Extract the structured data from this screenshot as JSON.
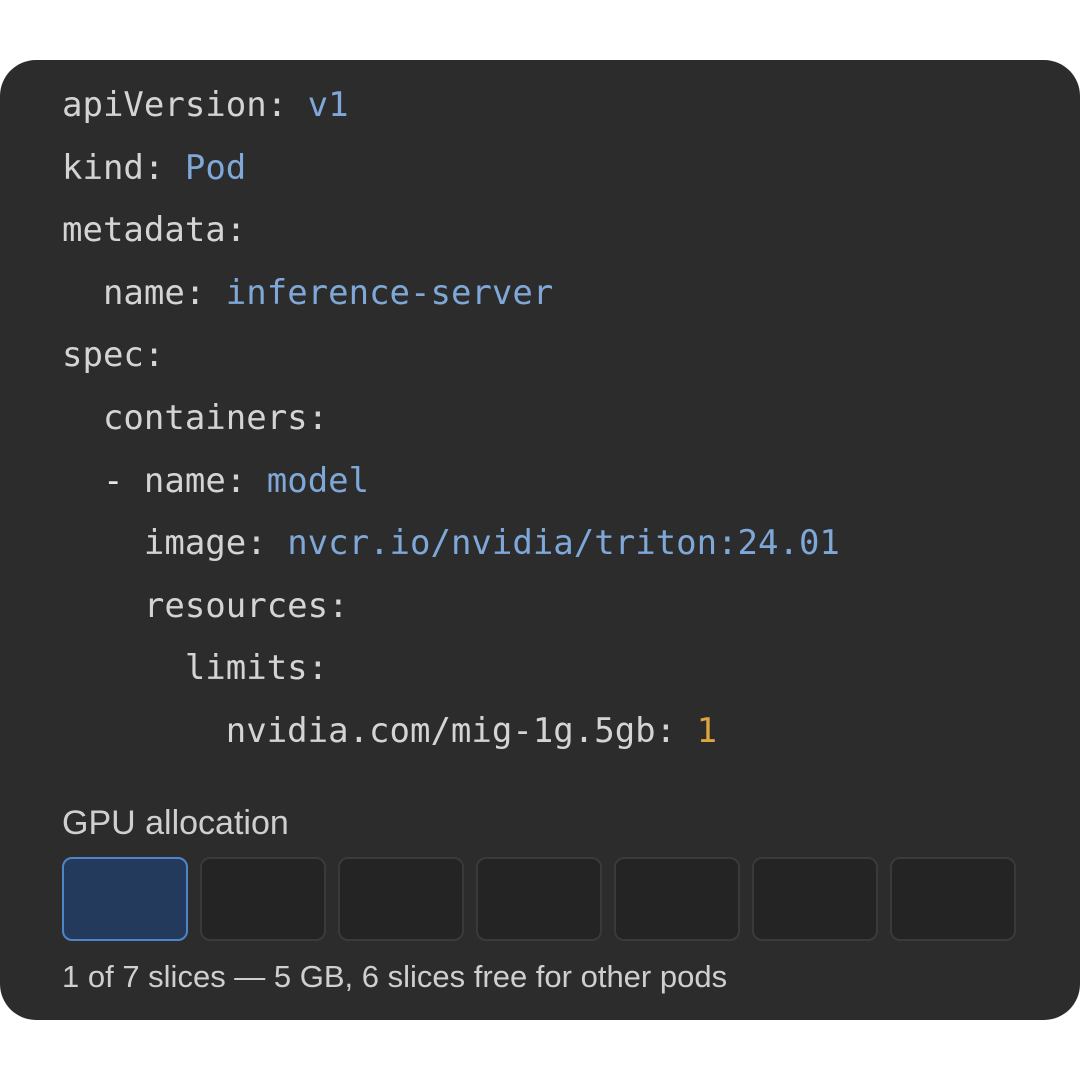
{
  "yaml": {
    "apiVersion_key": "apiVersion:",
    "apiVersion_val": "v1",
    "kind_key": "kind:",
    "kind_val": "Pod",
    "metadata_key": "metadata:",
    "metadata_name_key": "name:",
    "metadata_name_val": "inference-server",
    "spec_key": "spec:",
    "containers_key": "containers:",
    "dash": "-",
    "container_name_key": "name:",
    "container_name_val": "model",
    "image_key": "image:",
    "image_val": "nvcr.io/nvidia/triton:24.01",
    "resources_key": "resources:",
    "limits_key": "limits:",
    "mig_key": "nvidia.com/mig-1g.5gb:",
    "mig_val": "1"
  },
  "gpu_allocation": {
    "title": "GPU allocation",
    "total_slices": 7,
    "allocated_slices": 1,
    "caption": "1 of 7 slices — 5 GB, 6 slices free for other pods"
  },
  "colors": {
    "panel_bg": "#2c2c2c",
    "string_value": "#7fa8d9",
    "number_value": "#e0a43a",
    "slice_active_fill": "#243a5c",
    "slice_active_border": "#4f84c8"
  }
}
